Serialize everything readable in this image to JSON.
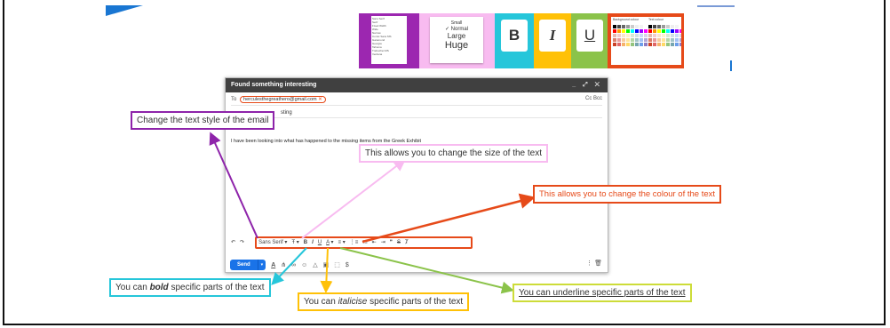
{
  "header_images": {
    "size_menu": [
      "Small",
      "Normal",
      "Large",
      "Huge"
    ],
    "format_buttons": [
      "B",
      "I",
      "U"
    ],
    "colour_panel": {
      "background_label": "Background colour",
      "text_label": "Text colour"
    }
  },
  "compose": {
    "title": "Found something interesting",
    "window_controls": "_ ⤢ ✕",
    "to_label": "To",
    "recipient": "herculesthegreathero@gmail.com",
    "cc_bcc": "Cc Bcc",
    "subject_fragment": "sting",
    "body": "I have been looking into what has happened to the missing items from the Greek Exhibit",
    "toolbar": {
      "undo": "↶",
      "redo": "↷",
      "font": "Sans Serif",
      "size": "Ŧ",
      "bold": "B",
      "italic": "I",
      "underline": "U",
      "text_colour": "A",
      "align": "≡",
      "numbered": "⋮≡",
      "bulleted": "⁝≡",
      "indent_less": "⇤",
      "indent_more": "⇥",
      "quote": "❞",
      "strikethrough": "S",
      "clear_format": "Ⱦ"
    },
    "send": "Send",
    "send_arrow": "▾",
    "bottom_tools": [
      "A",
      "⋔",
      "∞",
      "☺",
      "△",
      "▣",
      "⬚",
      "$"
    ],
    "bottom_right": "⋮ 🗑"
  },
  "callouts": {
    "style": "Change the text style of the email",
    "size": "This allows you to change the size of the text",
    "colour": "This allows you to change the colour of the text",
    "bold_prefix": "You can ",
    "bold_word": "bold",
    "bold_suffix": " specific parts of the text",
    "italic_prefix": "You can ",
    "italic_word": "italicise",
    "italic_suffix": " specific parts of the text",
    "underline": "You can underline specific parts of the text"
  },
  "colors": {
    "purple": "#8e24aa",
    "pink": "#f8bbf0",
    "cyan": "#26c6da",
    "yellow": "#ffc107",
    "green": "#8bc34a",
    "red": "#e64a19",
    "send_blue": "#1a73e8"
  }
}
